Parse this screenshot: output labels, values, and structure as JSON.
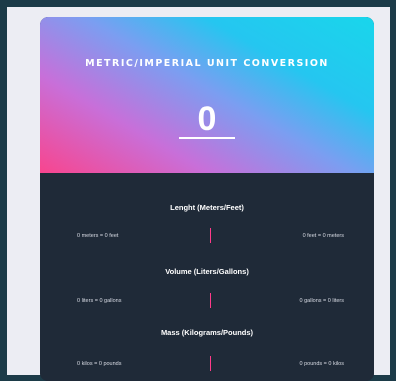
{
  "title": "METRIC/IMPERIAL UNIT CONVERSION",
  "input": {
    "value": "0"
  },
  "sections": [
    {
      "heading": "Lenght (Meters/Feet)",
      "left": "0 meters = 0 feet",
      "right": "0 feet = 0 meters"
    },
    {
      "heading": "Volume (Liters/Gallons)",
      "left": "0 liters = 0 gallons",
      "right": "0 gallons = 0 liters"
    },
    {
      "heading": "Mass (Kilograms/Pounds)",
      "left": "0 kilos = 0 pounds",
      "right": "0 pounds = 0 kilos"
    }
  ],
  "colors": {
    "accent_divider": "#ff3b8a",
    "panel_dark": "#1f2a38",
    "gradient_pink": "#f8458e",
    "gradient_cyan": "#19d6eb"
  }
}
